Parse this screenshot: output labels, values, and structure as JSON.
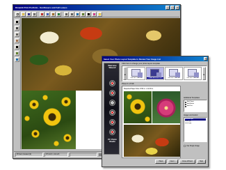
{
  "main_window": {
    "title": "Dinamik Print Portfolio - Sunflowers and Fall Leaves",
    "toolbar_icons": [
      "new-icon",
      "open-icon",
      "save-icon",
      "print-icon",
      "cut-icon",
      "copy-icon",
      "paste-icon",
      "undo-icon",
      "zoom-in-icon",
      "zoom-out-icon",
      "rotate-icon",
      "crop-icon",
      "text-icon",
      "color-icon",
      "help-icon"
    ],
    "left_tool_icons": [
      "select-icon",
      "move-icon",
      "zoom-icon",
      "pan-icon",
      "text-tool-icon",
      "crop-tool-icon",
      "rotate-tool-icon"
    ],
    "status": {
      "left": "Printers located (2)",
      "middle": "8.5 inch x 11 inch",
      "right": "Full Page Templ"
    }
  },
  "wizard": {
    "title": "Select Your Photo Layout Template to Review Your Image List",
    "side_title": "Welcome Wizard!",
    "side_logo": "PC Photo Studio",
    "instruction": "Click here to change your photo layout template",
    "thumbnails": [
      {
        "label": "Glue like a Sixt Print",
        "selected": false
      },
      {
        "label": "Center like a Sixt Print",
        "selected": true
      },
      {
        "label": "Glue like a Sixt Print",
        "selected": false
      },
      {
        "label": "Glue like a Sixt Print",
        "selected": false
      }
    ],
    "preview_caption": "Photo 6 x 8 6/8",
    "preview_sub": "Required Paper Size: 8.50 in. x 11.00 in.",
    "additional_templates_label": "Additional Templates",
    "additional_templates": [
      "Add Clipart",
      "Add Border",
      "Add Text"
    ],
    "image_list_label": "Image List Control",
    "image_list": [
      "sunflower.jpg",
      "flower.jpg",
      "leaves.jpg"
    ],
    "single_image_label": "Use Single Image",
    "buttons": {
      "back": "< Back",
      "next": "Next >",
      "close": "Close Wizard",
      "help": "Help"
    }
  }
}
